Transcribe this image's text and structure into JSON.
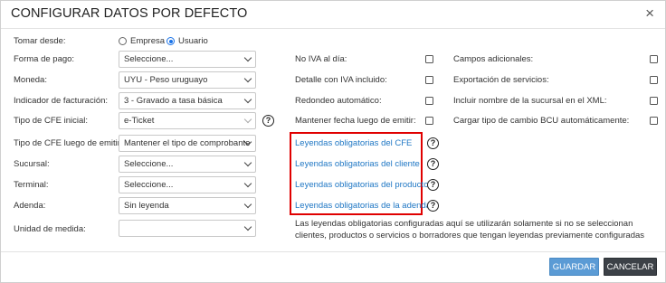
{
  "dialog": {
    "title": "CONFIGURAR DATOS POR DEFECTO",
    "close": "×"
  },
  "left": {
    "tomar_desde": {
      "label": "Tomar desde:",
      "options": [
        "Empresa",
        "Usuario"
      ],
      "selected": "Usuario"
    },
    "forma_pago": {
      "label": "Forma de pago:",
      "value": "Seleccione..."
    },
    "moneda": {
      "label": "Moneda:",
      "value": "UYU - Peso uruguayo"
    },
    "indicador": {
      "label": "Indicador de facturación:",
      "value": "3 - Gravado a tasa básica"
    },
    "tipo_cfe_inicial": {
      "label": "Tipo de CFE inicial:",
      "value": "e-Ticket"
    },
    "tipo_cfe_luego": {
      "label": "Tipo de CFE luego de emitir:",
      "value": "Mantener el tipo de comprobante"
    },
    "sucursal": {
      "label": "Sucursal:",
      "value": "Seleccione..."
    },
    "terminal": {
      "label": "Terminal:",
      "value": "Seleccione..."
    },
    "adenda": {
      "label": "Adenda:",
      "value": "Sin leyenda"
    },
    "unidad_medida": {
      "label": "Unidad de medida:",
      "value": ""
    }
  },
  "middle": {
    "no_iva": "No IVA al día:",
    "detalle_iva": "Detalle con IVA incluido:",
    "redondeo": "Redondeo automático:",
    "mantener_fecha": "Mantener fecha luego de emitir:",
    "links": [
      "Leyendas obligatorias del CFE",
      "Leyendas obligatorias del cliente",
      "Leyendas obligatorias del producto",
      "Leyendas obligatorias de la adenda"
    ],
    "note": "Las leyendas obligatorias configuradas aquí se utilizarán solamente si no se seleccionan clientes, productos o servicios o borradores que tengan leyendas previamente configuradas"
  },
  "right": {
    "campos": "Campos adicionales:",
    "exportacion": "Exportación de servicios:",
    "incluir_sucursal": "Incluir nombre de la sucursal en el XML:",
    "cargar_bcu": "Cargar tipo de cambio BCU automáticamente:"
  },
  "help_glyph": "?",
  "footer": {
    "save_label": "GUARDAR",
    "cancel_label": "CANCELAR"
  }
}
